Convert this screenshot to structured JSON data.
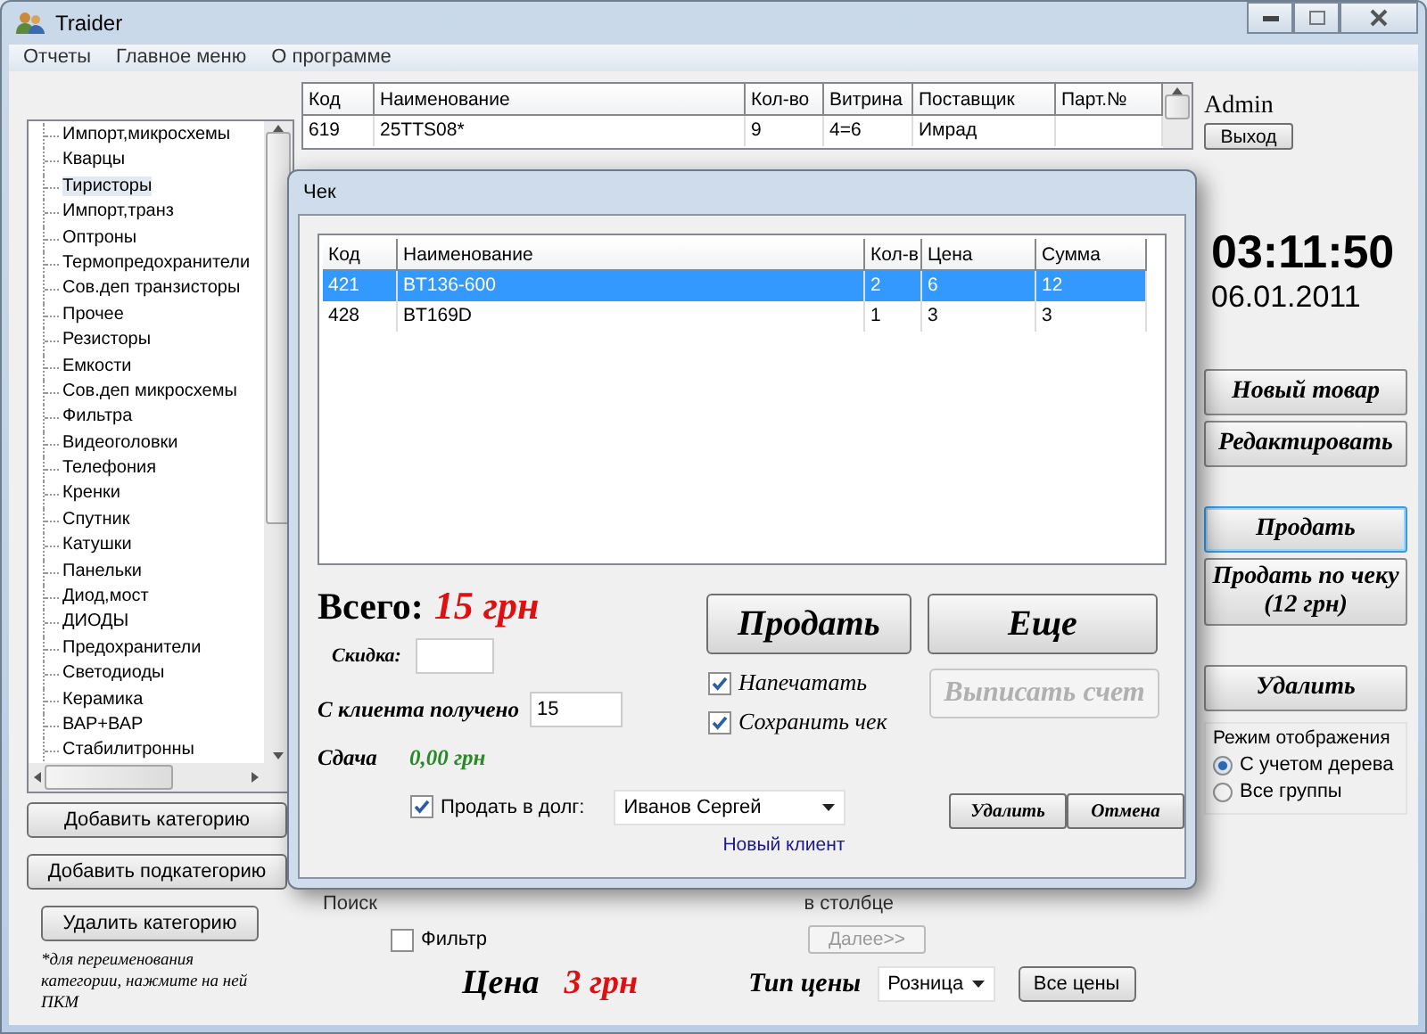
{
  "window": {
    "title": "Traider"
  },
  "menu": [
    "Отчеты",
    "Главное меню",
    "О программе"
  ],
  "categories": [
    {
      "label": "Импорт,микросхемы",
      "selected": false
    },
    {
      "label": "Кварцы",
      "selected": false
    },
    {
      "label": "Тиристоры",
      "selected": true
    },
    {
      "label": "Импорт,транз",
      "selected": false
    },
    {
      "label": "Оптроны",
      "selected": false
    },
    {
      "label": "Термопредохранители",
      "selected": false
    },
    {
      "label": "Сов.деп транзисторы",
      "selected": false
    },
    {
      "label": "Прочее",
      "selected": false
    },
    {
      "label": "Резисторы",
      "selected": false
    },
    {
      "label": "Емкости",
      "selected": false
    },
    {
      "label": "Сов.деп микросхемы",
      "selected": false
    },
    {
      "label": "Фильтра",
      "selected": false
    },
    {
      "label": "Видеоголовки",
      "selected": false
    },
    {
      "label": "Телефония",
      "selected": false
    },
    {
      "label": "Кренки",
      "selected": false
    },
    {
      "label": "Спутник",
      "selected": false
    },
    {
      "label": "Катушки",
      "selected": false
    },
    {
      "label": "Панельки",
      "selected": false
    },
    {
      "label": "Диод,мост",
      "selected": false
    },
    {
      "label": "ДИОДЫ",
      "selected": false
    },
    {
      "label": "Предохранители",
      "selected": false
    },
    {
      "label": "Светодиоды",
      "selected": false
    },
    {
      "label": "Керамика",
      "selected": false
    },
    {
      "label": "ВАР+ВАР",
      "selected": false
    },
    {
      "label": "Стабилитронны",
      "selected": false
    }
  ],
  "category_buttons": [
    "Добавить категорию",
    "Добавить подкатегорию",
    "Удалить категорию"
  ],
  "category_note": "*для переименования категории, нажмите на ней ПКМ",
  "products": {
    "columns": [
      "Код",
      "Наименование",
      "Кол-во",
      "Витрина",
      "Поставщик",
      "Парт.№"
    ],
    "rows": [
      {
        "cells": [
          "619",
          "25TTS08*",
          "9",
          "4=6",
          "Имрад"
        ]
      }
    ]
  },
  "search": {
    "label": "Поиск",
    "column_label": "в столбце",
    "filter": {
      "label": "Фильтр",
      "checked": false
    },
    "next_button": {
      "label": "Далее>>",
      "disabled": true
    }
  },
  "price": {
    "label": "Цена",
    "value": "3 грн",
    "type_label": "Тип цены",
    "type_value": "Розница",
    "all_prices_button": "Все цены"
  },
  "user": {
    "name": "Admin",
    "logout": "Выход"
  },
  "clock": {
    "time": "03:11:50",
    "date": "06.01.2011"
  },
  "action_groups": [
    [
      {
        "label": "Новый товар",
        "focused": false
      },
      {
        "label": "Редактировать",
        "focused": false
      }
    ],
    [
      {
        "label": "Продать",
        "focused": true
      },
      {
        "label": "Продать по чеку (12 грн)",
        "focused": false
      }
    ],
    [
      {
        "label": "Удалить",
        "focused": false
      }
    ]
  ],
  "display_mode": {
    "title": "Режим отображения",
    "options": [
      {
        "label": "С учетом дерева",
        "selected": true
      },
      {
        "label": "Все группы",
        "selected": false
      }
    ]
  },
  "dialog": {
    "title": "Чек",
    "columns": [
      "Код",
      "Наименование",
      "Кол-в",
      "Цена",
      "Сумма"
    ],
    "rows": [
      {
        "cells": [
          "421",
          "BT136-600",
          "2",
          "6",
          "12"
        ],
        "selected": true
      },
      {
        "cells": [
          "428",
          "BT169D",
          "1",
          "3",
          "3"
        ],
        "selected": false
      }
    ],
    "total_label": "Всего:",
    "total": "15 грн",
    "discount_label": "Скидка:",
    "received_label": "С клиента получено",
    "received": "15",
    "change_label": "Сдача",
    "change": "0,00 грн",
    "sell": "Продать",
    "more": "Еще",
    "invoice": {
      "label": "Выписать счет",
      "disabled": true
    },
    "options": [
      {
        "label": "Напечатать",
        "checked": true
      },
      {
        "label": "Сохранить чек",
        "checked": true
      }
    ],
    "debt": {
      "label": "Продать в долг:",
      "checked": true,
      "client": "Иванов Сергей",
      "new_client": "Новый клиент"
    },
    "delete": "Удалить",
    "cancel": "Отмена"
  }
}
